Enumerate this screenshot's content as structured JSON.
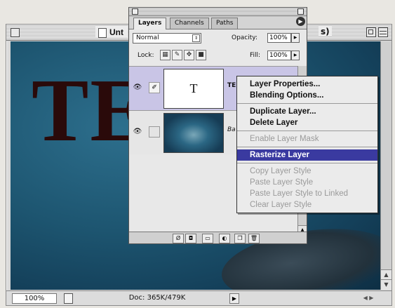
{
  "document": {
    "title_start": "Unt",
    "title_end": "s)",
    "zoom": "100%",
    "doc_size": "Doc: 365K/479K",
    "canvas_text": "TE"
  },
  "palette": {
    "tabs": [
      "Layers",
      "Channels",
      "Paths"
    ],
    "active_tab": "Layers",
    "blend_mode": "Normal",
    "opacity_label": "Opacity:",
    "opacity_value": "100%",
    "lock_label": "Lock:",
    "fill_label": "Fill:",
    "fill_value": "100%",
    "layers": [
      {
        "name": "TE",
        "thumb_text": "T",
        "selected": true
      },
      {
        "name": "Ba"
      }
    ]
  },
  "context_menu": {
    "items": [
      {
        "label": "Layer Properties...",
        "enabled": true
      },
      {
        "label": "Blending Options...",
        "enabled": true
      },
      {
        "label": "Duplicate Layer...",
        "enabled": true
      },
      {
        "label": "Delete Layer",
        "enabled": true
      },
      {
        "label": "Enable Layer Mask",
        "enabled": false
      },
      {
        "label": "Rasterize Layer",
        "enabled": true,
        "highlighted": true
      },
      {
        "label": "Copy Layer Style",
        "enabled": false
      },
      {
        "label": "Paste Layer Style",
        "enabled": false
      },
      {
        "label": "Paste Layer Style to Linked",
        "enabled": false
      },
      {
        "label": "Clear Layer Style",
        "enabled": false
      }
    ]
  },
  "colors": {
    "menu_highlight": "#3a3aa0",
    "selected_layer": "#c9c5e6",
    "canvas_text": "#2a0a0a",
    "water": "#1d5570"
  },
  "icons": [
    "eye-icon",
    "brush-icon",
    "lock-transparent-icon",
    "lock-image-icon",
    "lock-position-icon",
    "lock-all-icon",
    "palette-menu-icon",
    "layer-style-icon",
    "layer-mask-icon",
    "new-set-icon",
    "adjustment-layer-icon",
    "new-layer-icon",
    "trash-icon",
    "document-info-icon"
  ]
}
